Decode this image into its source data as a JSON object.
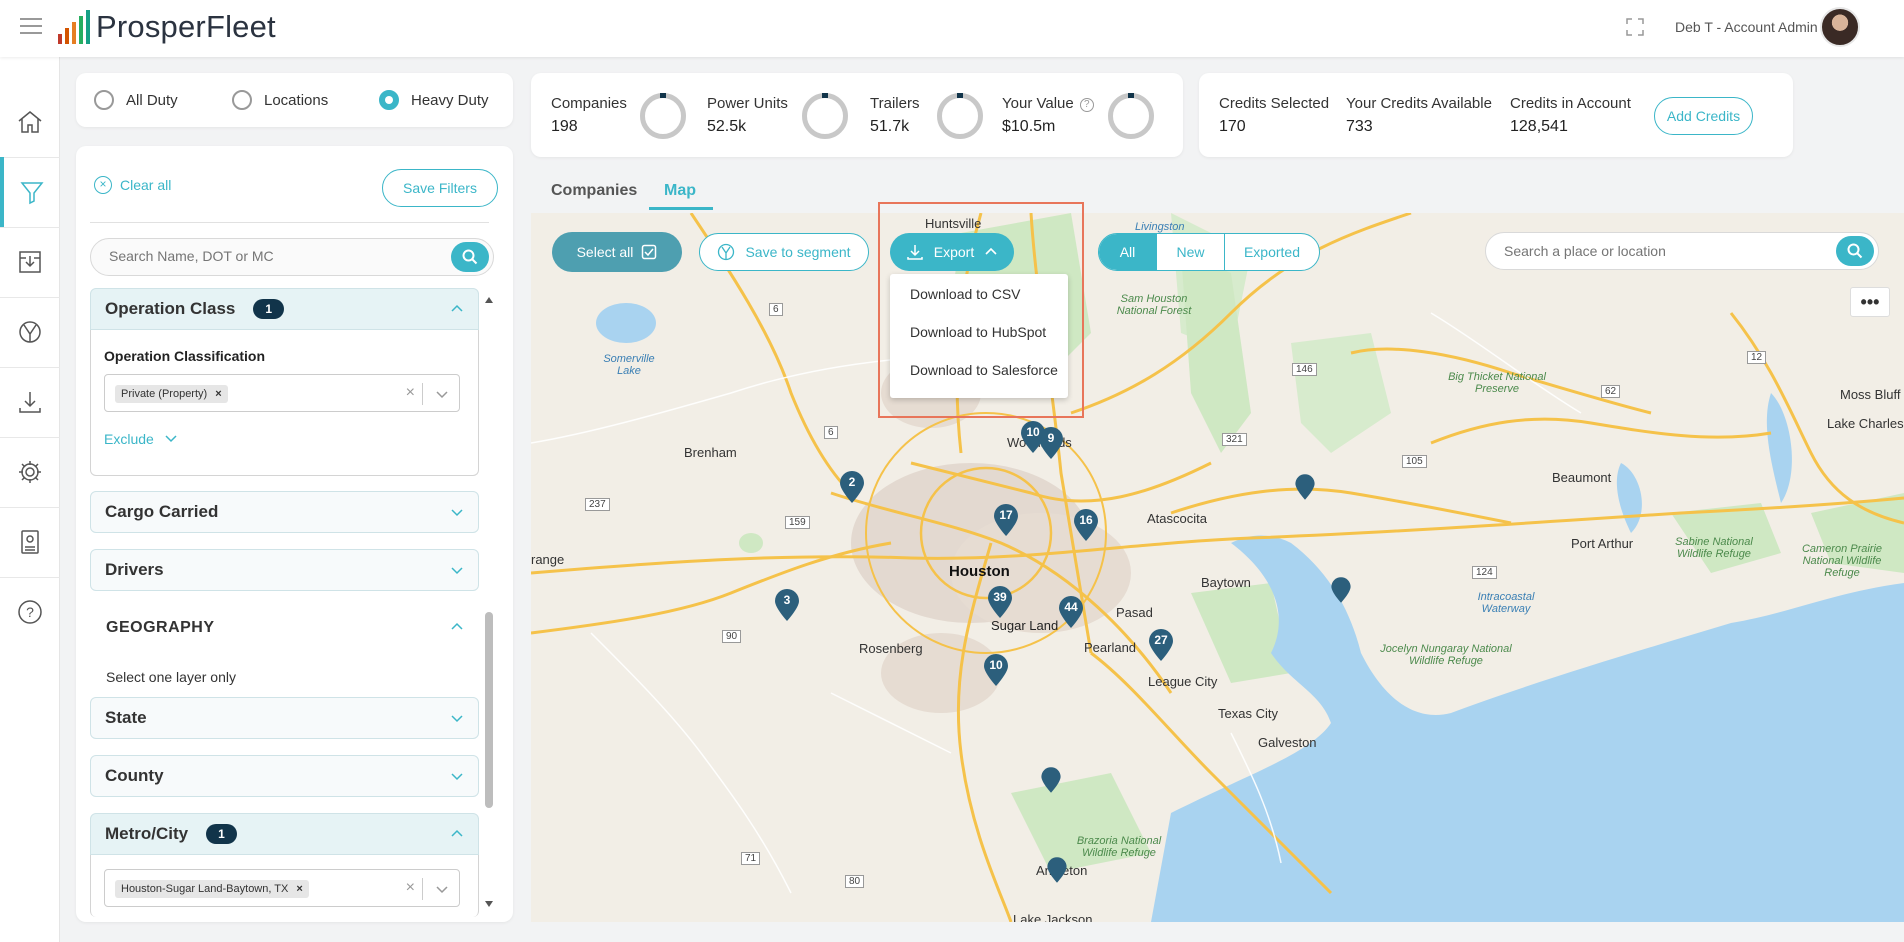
{
  "header": {
    "brand": "ProsperFleet",
    "user": "Deb T - Account Admin"
  },
  "scope": {
    "options": [
      {
        "label": "All Duty",
        "selected": false
      },
      {
        "label": "Locations",
        "selected": false
      },
      {
        "label": "Heavy Duty",
        "selected": true
      }
    ]
  },
  "stats": {
    "companies_label": "Companies",
    "companies_value": "198",
    "power_units_label": "Power Units",
    "power_units_value": "52.5k",
    "trailers_label": "Trailers",
    "trailers_value": "51.7k",
    "your_value_label": "Your Value",
    "your_value_value": "$10.5m",
    "help": "?"
  },
  "credits": {
    "selected_label": "Credits Selected",
    "selected_value": "170",
    "available_label": "Your Credits Available",
    "available_value": "733",
    "account_label": "Credits in Account",
    "account_value": "128,541",
    "add_button": "Add Credits"
  },
  "filters": {
    "clear_all": "Clear all",
    "save_filters": "Save Filters",
    "search_placeholder": "Search Name, DOT or MC",
    "operation_class": {
      "title": "Operation Class",
      "count": "1",
      "sub_label": "Operation Classification",
      "chip": "Private (Property)",
      "exclude": "Exclude"
    },
    "cargo_carried": "Cargo Carried",
    "drivers": "Drivers",
    "geography_title": "GEOGRAPHY",
    "geography_note": "Select one layer only",
    "state": "State",
    "county": "County",
    "metro_city": {
      "title": "Metro/City",
      "count": "1",
      "chip": "Houston-Sugar Land-Baytown, TX"
    }
  },
  "tabs": {
    "companies": "Companies",
    "map": "Map"
  },
  "map_toolbar": {
    "select_all": "Select all",
    "save_to_segment": "Save to segment",
    "export": "Export",
    "filter_all": "All",
    "filter_new": "New",
    "filter_exported": "Exported",
    "search_placeholder": "Search a place or location",
    "more": "•••"
  },
  "export_menu": [
    "Download to CSV",
    "Download to HubSpot",
    "Download to Salesforce"
  ],
  "map_pins": [
    "10",
    "9",
    "2",
    "17",
    "16",
    "3",
    "39",
    "44",
    "27",
    "10"
  ],
  "map_places": {
    "houston": "Houston",
    "huntsville": "Huntsville",
    "livingston": "Livingston",
    "sam_houston": "Sam Houston National Forest",
    "somerville": "Somerville Lake",
    "brenham": "Brenham",
    "woodlands": "Woodlands",
    "atascocita": "Atascocita",
    "baytown": "Baytown",
    "pasadena": "Pasad",
    "sugar_land": "Sugar Land",
    "rosenberg": "Rosenberg",
    "pearland": "Pearland",
    "league_city": "League City",
    "texas_city": "Texas City",
    "galveston": "Galveston",
    "beaumont": "Beaumont",
    "port_arthur": "Port Arthur",
    "moss_bluff": "Moss Bluff",
    "lake_charles": "Lake Charles",
    "big_thicket": "Big Thicket National Preserve",
    "sabine": "Sabine National Wildlife Refuge",
    "cameron": "Cameron Prairie National Wildlife Refuge",
    "anahuac": "Jocelyn Nungaray National Wildlife Refuge",
    "intracoastal": "Intracoastal Waterway",
    "brazoria": "Brazoria National Wildlife Refuge",
    "angleton": "Angleton",
    "grange": "range",
    "lake_jackson": "Lake Jackson"
  },
  "map_highways": [
    "6",
    "146",
    "12",
    "62",
    "6",
    "321",
    "105",
    "237",
    "159",
    "90",
    "124",
    "71",
    "80"
  ],
  "colors": {
    "accent": "#3bb6c8",
    "dark_badge": "#11344a",
    "pin": "#2c5f7c",
    "highlight": "#e8755a"
  }
}
